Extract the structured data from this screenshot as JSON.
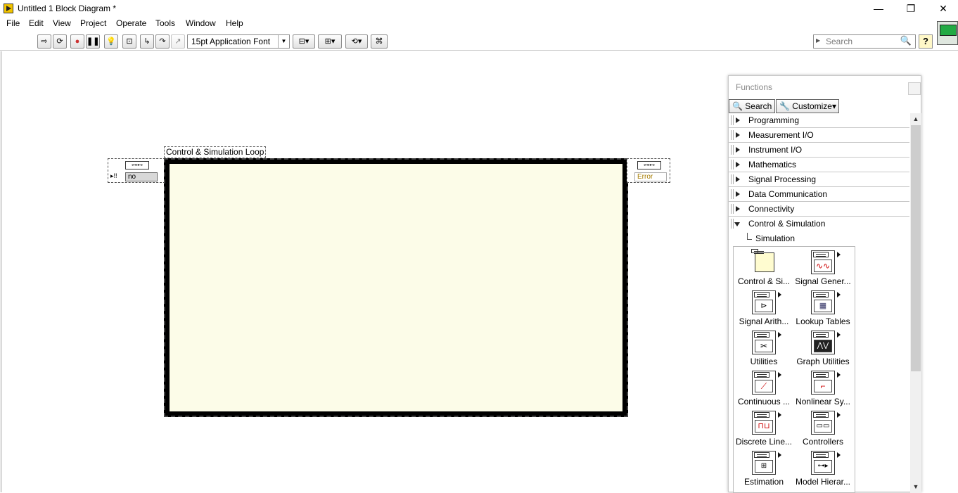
{
  "window": {
    "title": "Untitled 1 Block Diagram *",
    "minimize": "—",
    "restore": "❐",
    "close": "✕"
  },
  "menu": [
    "File",
    "Edit",
    "View",
    "Project",
    "Operate",
    "Tools",
    "Window",
    "Help"
  ],
  "toolbar": {
    "font_selector": "15pt Application Font",
    "search_placeholder": "Search",
    "help_label": "?"
  },
  "diagram": {
    "loop_label": "Control & Simulation Loop",
    "input_node_value": "no",
    "output_node_value": "Error"
  },
  "functions_panel": {
    "title": "Functions",
    "search_button": "Search",
    "customize_button": "Customize▾",
    "categories": [
      {
        "label": "Programming",
        "open": false
      },
      {
        "label": "Measurement I/O",
        "open": false
      },
      {
        "label": "Instrument I/O",
        "open": false
      },
      {
        "label": "Mathematics",
        "open": false
      },
      {
        "label": "Signal Processing",
        "open": false
      },
      {
        "label": "Data Communication",
        "open": false
      },
      {
        "label": "Connectivity",
        "open": false
      },
      {
        "label": "Control & Simulation",
        "open": true
      }
    ],
    "subcategory": "Simulation",
    "palette_items": [
      {
        "label": "Control & Si..."
      },
      {
        "label": "Signal Gener..."
      },
      {
        "label": "Signal Arith..."
      },
      {
        "label": "Lookup Tables"
      },
      {
        "label": "Utilities"
      },
      {
        "label": "Graph Utilities"
      },
      {
        "label": "Continuous ..."
      },
      {
        "label": "Nonlinear Sy..."
      },
      {
        "label": "Discrete Line..."
      },
      {
        "label": "Controllers"
      },
      {
        "label": "Estimation"
      },
      {
        "label": "Model Hierar..."
      }
    ]
  },
  "colors": {
    "loop_border": "#000000",
    "loop_fill": "#fcfce8",
    "panel_bg": "#ffffff"
  }
}
